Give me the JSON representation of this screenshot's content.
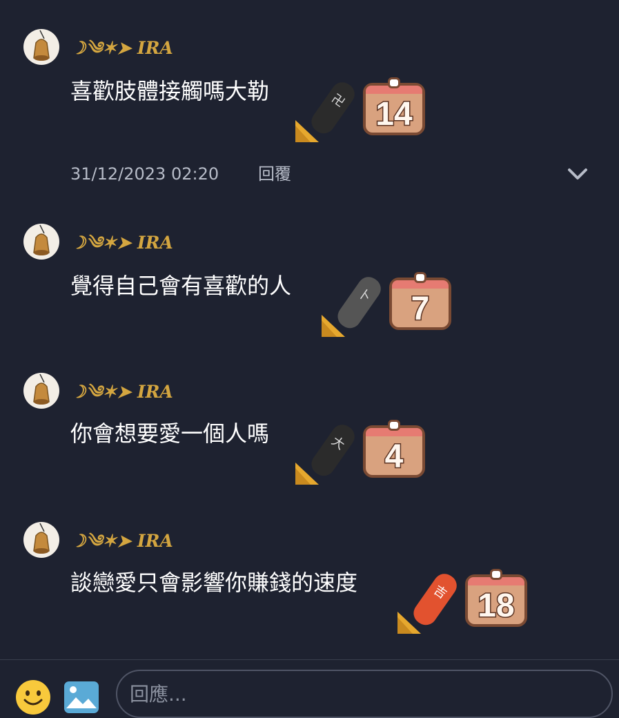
{
  "comments": [
    {
      "username": "☽༄✶➤ 𝑰𝑹𝑨",
      "text": "喜歡肢體接觸嗎大勒",
      "reaction_count": "14",
      "stamp_color": "#2b2b2b",
      "stamp_glyph": "卍"
    },
    {
      "username": "☽༄✶➤ 𝑰𝑹𝑨",
      "text": "覺得自己會有喜歡的人",
      "reaction_count": "7",
      "stamp_color": "#555555",
      "stamp_glyph": "卜"
    },
    {
      "username": "☽༄✶➤ 𝑰𝑹𝑨",
      "text": "你會想要愛一個人嗎",
      "reaction_count": "4",
      "stamp_color": "#2b2b2b",
      "stamp_glyph": "大"
    },
    {
      "username": "☽༄✶➤ 𝑰𝑹𝑨",
      "text": "談戀愛只會影響你賺錢的速度",
      "reaction_count": "18",
      "stamp_color": "#e2522f",
      "stamp_glyph": "吉"
    }
  ],
  "meta": {
    "timestamp": "31/12/2023 02:20",
    "reply_label": "回覆"
  },
  "composer": {
    "placeholder": "回應..."
  },
  "icons": {
    "avatar": "bell-avatar-icon",
    "expand": "chevron-down-icon",
    "emoji": "smiley-emoji-icon",
    "image": "image-icon",
    "stamp": "stamp-icon",
    "calendar": "calendar-icon"
  },
  "colors": {
    "background": "#1e2230",
    "username": "#d4a640",
    "meta": "#b7bcc8",
    "calendar": "#d9a27f"
  }
}
